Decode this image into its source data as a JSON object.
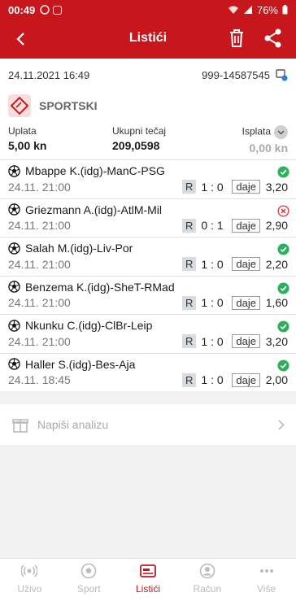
{
  "status_bar": {
    "time": "00:49",
    "battery": "76%"
  },
  "app_bar": {
    "title": "Listići"
  },
  "slip": {
    "datetime": "24.11.2021 16:49",
    "code": "999-14587545",
    "sport_label": "SPORTSKI",
    "uplata_label": "Uplata",
    "uplata_value": "5,00 kn",
    "tecaj_label": "Ukupni tečaj",
    "tecaj_value": "209,0598",
    "isplata_label": "Isplata",
    "isplata_value": "0,00 kn"
  },
  "bets": [
    {
      "match": "Mbappe K.(idg)-ManC-PSG",
      "date": "24.11. 21:00",
      "tag": "R",
      "score": "1 : 0",
      "pick": "daje",
      "odds": "3,20",
      "status": "won"
    },
    {
      "match": "Griezmann A.(idg)-AtlM-Mil",
      "date": "24.11. 21:00",
      "tag": "R",
      "score": "0 : 1",
      "pick": "daje",
      "odds": "2,90",
      "status": "lost"
    },
    {
      "match": "Salah M.(idg)-Liv-Por",
      "date": "24.11. 21:00",
      "tag": "R",
      "score": "1 : 0",
      "pick": "daje",
      "odds": "2,20",
      "status": "won"
    },
    {
      "match": "Benzema K.(idg)-SheT-RMad",
      "date": "24.11. 21:00",
      "tag": "R",
      "score": "1 : 0",
      "pick": "daje",
      "odds": "1,60",
      "status": "won"
    },
    {
      "match": "Nkunku C.(idg)-ClBr-Leip",
      "date": "24.11. 21:00",
      "tag": "R",
      "score": "1 : 0",
      "pick": "daje",
      "odds": "3,20",
      "status": "won"
    },
    {
      "match": "Haller S.(idg)-Bes-Aja",
      "date": "24.11. 18:45",
      "tag": "R",
      "score": "1 : 0",
      "pick": "daje",
      "odds": "2,00",
      "status": "won"
    }
  ],
  "analysis": {
    "placeholder": "Napiši analizu"
  },
  "nav": {
    "items": [
      {
        "label": "Uživo",
        "icon": "live-icon"
      },
      {
        "label": "Sport",
        "icon": "ball-icon"
      },
      {
        "label": "Listići",
        "icon": "ticket-icon"
      },
      {
        "label": "Račun",
        "icon": "user-icon"
      },
      {
        "label": "Više",
        "icon": "more-icon"
      }
    ],
    "active": "Listići"
  },
  "colors": {
    "brand": "#c8161d",
    "won": "#2eaf5c",
    "lost": "#d63b3b"
  }
}
